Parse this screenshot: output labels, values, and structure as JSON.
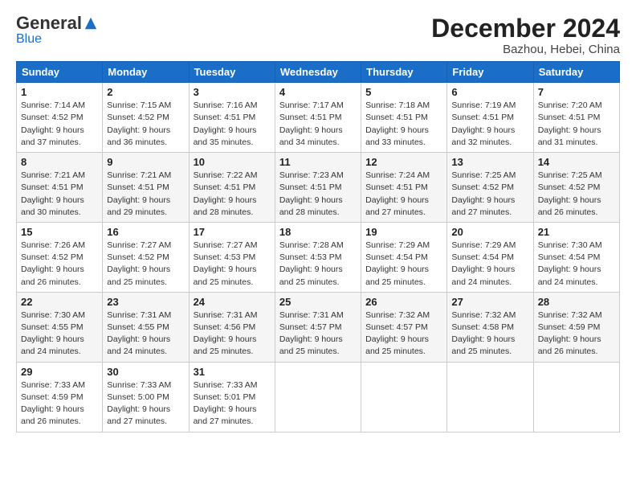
{
  "logo": {
    "general": "General",
    "blue": "Blue"
  },
  "header": {
    "month_title": "December 2024",
    "location": "Bazhou, Hebei, China"
  },
  "weekdays": [
    "Sunday",
    "Monday",
    "Tuesday",
    "Wednesday",
    "Thursday",
    "Friday",
    "Saturday"
  ],
  "weeks": [
    [
      {
        "day": "1",
        "sunrise": "7:14 AM",
        "sunset": "4:52 PM",
        "daylight": "9 hours and 37 minutes."
      },
      {
        "day": "2",
        "sunrise": "7:15 AM",
        "sunset": "4:52 PM",
        "daylight": "9 hours and 36 minutes."
      },
      {
        "day": "3",
        "sunrise": "7:16 AM",
        "sunset": "4:51 PM",
        "daylight": "9 hours and 35 minutes."
      },
      {
        "day": "4",
        "sunrise": "7:17 AM",
        "sunset": "4:51 PM",
        "daylight": "9 hours and 34 minutes."
      },
      {
        "day": "5",
        "sunrise": "7:18 AM",
        "sunset": "4:51 PM",
        "daylight": "9 hours and 33 minutes."
      },
      {
        "day": "6",
        "sunrise": "7:19 AM",
        "sunset": "4:51 PM",
        "daylight": "9 hours and 32 minutes."
      },
      {
        "day": "7",
        "sunrise": "7:20 AM",
        "sunset": "4:51 PM",
        "daylight": "9 hours and 31 minutes."
      }
    ],
    [
      {
        "day": "8",
        "sunrise": "7:21 AM",
        "sunset": "4:51 PM",
        "daylight": "9 hours and 30 minutes."
      },
      {
        "day": "9",
        "sunrise": "7:21 AM",
        "sunset": "4:51 PM",
        "daylight": "9 hours and 29 minutes."
      },
      {
        "day": "10",
        "sunrise": "7:22 AM",
        "sunset": "4:51 PM",
        "daylight": "9 hours and 28 minutes."
      },
      {
        "day": "11",
        "sunrise": "7:23 AM",
        "sunset": "4:51 PM",
        "daylight": "9 hours and 28 minutes."
      },
      {
        "day": "12",
        "sunrise": "7:24 AM",
        "sunset": "4:51 PM",
        "daylight": "9 hours and 27 minutes."
      },
      {
        "day": "13",
        "sunrise": "7:25 AM",
        "sunset": "4:52 PM",
        "daylight": "9 hours and 27 minutes."
      },
      {
        "day": "14",
        "sunrise": "7:25 AM",
        "sunset": "4:52 PM",
        "daylight": "9 hours and 26 minutes."
      }
    ],
    [
      {
        "day": "15",
        "sunrise": "7:26 AM",
        "sunset": "4:52 PM",
        "daylight": "9 hours and 26 minutes."
      },
      {
        "day": "16",
        "sunrise": "7:27 AM",
        "sunset": "4:52 PM",
        "daylight": "9 hours and 25 minutes."
      },
      {
        "day": "17",
        "sunrise": "7:27 AM",
        "sunset": "4:53 PM",
        "daylight": "9 hours and 25 minutes."
      },
      {
        "day": "18",
        "sunrise": "7:28 AM",
        "sunset": "4:53 PM",
        "daylight": "9 hours and 25 minutes."
      },
      {
        "day": "19",
        "sunrise": "7:29 AM",
        "sunset": "4:54 PM",
        "daylight": "9 hours and 25 minutes."
      },
      {
        "day": "20",
        "sunrise": "7:29 AM",
        "sunset": "4:54 PM",
        "daylight": "9 hours and 24 minutes."
      },
      {
        "day": "21",
        "sunrise": "7:30 AM",
        "sunset": "4:54 PM",
        "daylight": "9 hours and 24 minutes."
      }
    ],
    [
      {
        "day": "22",
        "sunrise": "7:30 AM",
        "sunset": "4:55 PM",
        "daylight": "9 hours and 24 minutes."
      },
      {
        "day": "23",
        "sunrise": "7:31 AM",
        "sunset": "4:55 PM",
        "daylight": "9 hours and 24 minutes."
      },
      {
        "day": "24",
        "sunrise": "7:31 AM",
        "sunset": "4:56 PM",
        "daylight": "9 hours and 25 minutes."
      },
      {
        "day": "25",
        "sunrise": "7:31 AM",
        "sunset": "4:57 PM",
        "daylight": "9 hours and 25 minutes."
      },
      {
        "day": "26",
        "sunrise": "7:32 AM",
        "sunset": "4:57 PM",
        "daylight": "9 hours and 25 minutes."
      },
      {
        "day": "27",
        "sunrise": "7:32 AM",
        "sunset": "4:58 PM",
        "daylight": "9 hours and 25 minutes."
      },
      {
        "day": "28",
        "sunrise": "7:32 AM",
        "sunset": "4:59 PM",
        "daylight": "9 hours and 26 minutes."
      }
    ],
    [
      {
        "day": "29",
        "sunrise": "7:33 AM",
        "sunset": "4:59 PM",
        "daylight": "9 hours and 26 minutes."
      },
      {
        "day": "30",
        "sunrise": "7:33 AM",
        "sunset": "5:00 PM",
        "daylight": "9 hours and 27 minutes."
      },
      {
        "day": "31",
        "sunrise": "7:33 AM",
        "sunset": "5:01 PM",
        "daylight": "9 hours and 27 minutes."
      },
      null,
      null,
      null,
      null
    ]
  ]
}
